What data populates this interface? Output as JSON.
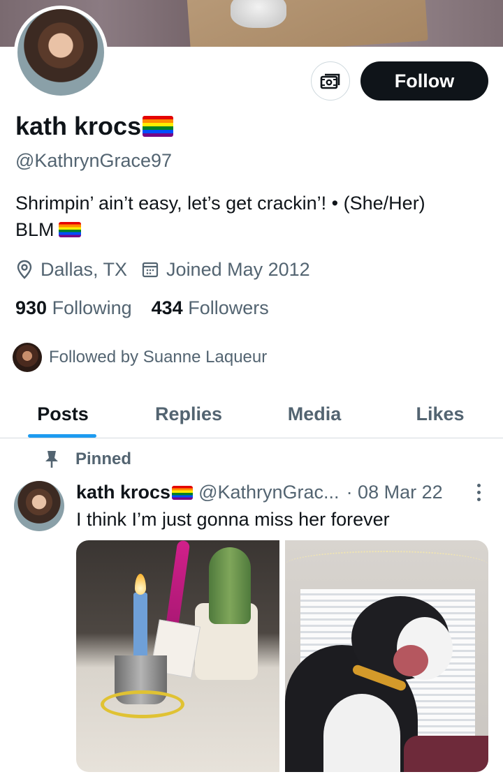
{
  "profile": {
    "display_name": "kath krocs",
    "handle": "@KathrynGrace97",
    "bio_line1": "Shrimpin’ ain’t easy, let’s get crackin’! • (She/Her)",
    "bio_line2": "BLM",
    "location": "Dallas, TX",
    "joined": "Joined May 2012",
    "following_count": "930",
    "following_label": "Following",
    "followers_count": "434",
    "followers_label": "Followers",
    "followed_by": "Followed by Suanne Laqueur"
  },
  "actions": {
    "follow_label": "Follow"
  },
  "tabs": [
    {
      "label": "Posts",
      "active": true
    },
    {
      "label": "Replies",
      "active": false
    },
    {
      "label": "Media",
      "active": false
    },
    {
      "label": "Likes",
      "active": false
    }
  ],
  "pinned_tweet": {
    "pinned_label": "Pinned",
    "author_name": "kath krocs",
    "author_handle": "@KathrynGrac...",
    "date": "· 08 Mar 22",
    "text": "I think I’m just gonna miss her forever"
  },
  "colors": {
    "accent": "#1d9bf0",
    "text_primary": "#0f1419",
    "text_secondary": "#536471",
    "follow_button_bg": "#0f1419"
  }
}
